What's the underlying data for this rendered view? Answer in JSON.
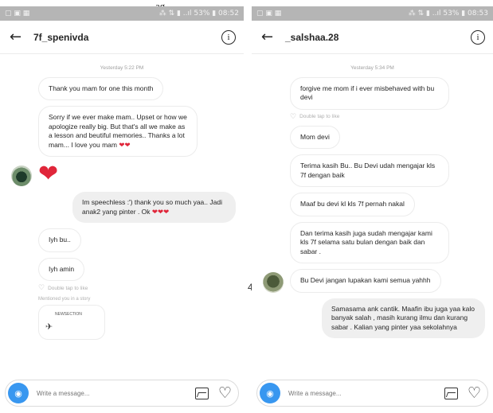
{
  "top_text": "ag",
  "stray_mark": "4",
  "colors": {
    "heart": "#e0263a",
    "camera": "#3897f0",
    "status_bar": "#b5b5b5",
    "sent_bubble": "#efefef"
  },
  "left": {
    "status": {
      "left_icons": "▢ ▣ ▦",
      "right_text": "⁂ ⇅ ▮ ..ıl 53% ▮ 08:52"
    },
    "header": {
      "back_icon": "arrow-left-icon",
      "username": "7f_spenivda",
      "info_icon": "info-icon"
    },
    "timestamp": "Yesterday 5:22 PM",
    "msg1": "Thank you mam for one this month",
    "msg2": "Sorry if we ever make mam.. Upset or how we apologize really big. But that's all we make as a lesson and beutiful memories.. Thanks a lot mam... I love you mam",
    "msg2_hearts": "❤❤",
    "reaction_heart": "❤",
    "sent1": "Im speechless :') thank you so much yaa.. Jadi anak2 yang pinter . Ok",
    "sent1_hearts": "❤❤❤",
    "msg3": "Iyh bu..",
    "msg4": "Iyh amin",
    "like_hint": "Double tap to like",
    "note": "Mentioned you in a story",
    "shared_title": "NEWSECTION",
    "composer_placeholder": "Write a message..."
  },
  "right": {
    "status": {
      "left_icons": "▢ ▣ ▦",
      "right_text": "⁂ ⇅ ▮ ..ıl 53% ▮ 08:53"
    },
    "header": {
      "back_icon": "arrow-left-icon",
      "username": "_salshaa.28",
      "info_icon": "info-icon"
    },
    "timestamp": "Yesterday 5:34 PM",
    "msg1": "forgive me mom if i ever misbehaved with bu devi",
    "like_hint": "Double tap to like",
    "msg2": "Mom devi",
    "msg3": "Terima kasih Bu.. Bu Devi udah mengajar kls 7f dengan baik",
    "msg4": "Maaf bu devi kl kls 7f pernah nakal",
    "msg5": "Dan terima kasih juga sudah mengajar kami kls 7f selama satu bulan dengan baik dan sabar .",
    "msg6": "Bu Devi jangan lupakan kami semua yahhh",
    "sent1": "Samasama ank cantik. Maafin ibu juga yaa kalo banyak salah , masih kurang ilmu dan kurang sabar . Kalian yang pinter yaa sekolahnya",
    "composer_placeholder": "Write a message..."
  }
}
